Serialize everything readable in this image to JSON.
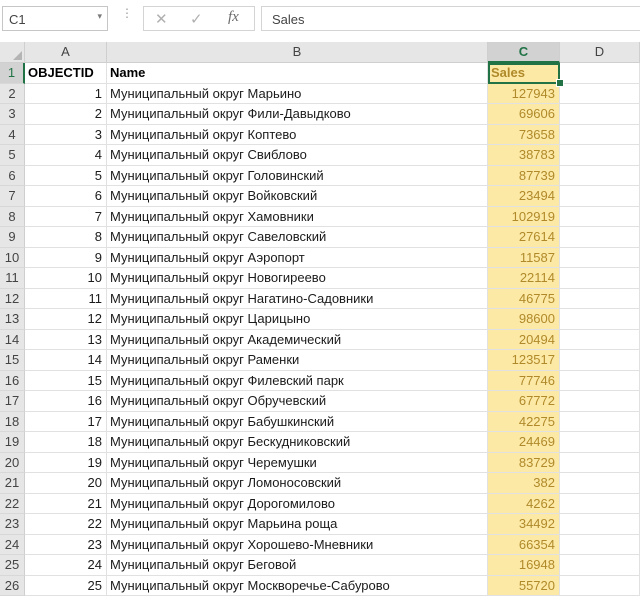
{
  "formula_bar": {
    "name_box": "C1",
    "name_box_arrow": "▾",
    "dots": "⋮",
    "cancel_icon": "✕",
    "enter_icon": "✓",
    "fx_label": "fx",
    "formula_value": "Sales"
  },
  "columns": [
    {
      "letter": "A"
    },
    {
      "letter": "B"
    },
    {
      "letter": "C"
    },
    {
      "letter": "D"
    }
  ],
  "selected_column": "C",
  "selected_row": "1",
  "headers": {
    "a": "OBJECTID",
    "b": "Name",
    "c": "Sales"
  },
  "rows": [
    {
      "n": "2",
      "id": "1",
      "name": "Муниципальный округ Марьино",
      "sales": "127943"
    },
    {
      "n": "3",
      "id": "2",
      "name": "Муниципальный округ Фили-Давыдково",
      "sales": "69606"
    },
    {
      "n": "4",
      "id": "3",
      "name": "Муниципальный округ Коптево",
      "sales": "73658"
    },
    {
      "n": "5",
      "id": "4",
      "name": "Муниципальный округ Свиблово",
      "sales": "38783"
    },
    {
      "n": "6",
      "id": "5",
      "name": "Муниципальный округ Головинский",
      "sales": "87739"
    },
    {
      "n": "7",
      "id": "6",
      "name": "Муниципальный округ Войковский",
      "sales": "23494"
    },
    {
      "n": "8",
      "id": "7",
      "name": "Муниципальный округ Хамовники",
      "sales": "102919"
    },
    {
      "n": "9",
      "id": "8",
      "name": "Муниципальный округ Савеловский",
      "sales": "27614"
    },
    {
      "n": "10",
      "id": "9",
      "name": "Муниципальный округ Аэропорт",
      "sales": "11587"
    },
    {
      "n": "11",
      "id": "10",
      "name": "Муниципальный округ Новогиреево",
      "sales": "22114"
    },
    {
      "n": "12",
      "id": "11",
      "name": "Муниципальный округ Нагатино-Садовники",
      "sales": "46775"
    },
    {
      "n": "13",
      "id": "12",
      "name": "Муниципальный округ Царицыно",
      "sales": "98600"
    },
    {
      "n": "14",
      "id": "13",
      "name": "Муниципальный округ Академический",
      "sales": "20494"
    },
    {
      "n": "15",
      "id": "14",
      "name": "Муниципальный округ Раменки",
      "sales": "123517"
    },
    {
      "n": "16",
      "id": "15",
      "name": "Муниципальный округ Филевский парк",
      "sales": "77746"
    },
    {
      "n": "17",
      "id": "16",
      "name": "Муниципальный округ Обручевский",
      "sales": "67772"
    },
    {
      "n": "18",
      "id": "17",
      "name": "Муниципальный округ Бабушкинский",
      "sales": "42275"
    },
    {
      "n": "19",
      "id": "18",
      "name": "Муниципальный округ Бескудниковский",
      "sales": "24469"
    },
    {
      "n": "20",
      "id": "19",
      "name": "Муниципальный округ Черемушки",
      "sales": "83729"
    },
    {
      "n": "21",
      "id": "20",
      "name": "Муниципальный округ Ломоносовский",
      "sales": "382"
    },
    {
      "n": "22",
      "id": "21",
      "name": "Муниципальный округ Дорогомилово",
      "sales": "4262"
    },
    {
      "n": "23",
      "id": "22",
      "name": "Муниципальный округ Марьина роща",
      "sales": "34492"
    },
    {
      "n": "24",
      "id": "23",
      "name": "Муниципальный округ Хорошево-Мневники",
      "sales": "66354"
    },
    {
      "n": "25",
      "id": "24",
      "name": "Муниципальный округ Беговой",
      "sales": "16948"
    },
    {
      "n": "26",
      "id": "25",
      "name": "Муниципальный округ Москворечье-Сабурово",
      "sales": "55720"
    }
  ],
  "colors": {
    "selection_green": "#217346",
    "sales_fill": "#fde9a6",
    "sales_text": "#b08a2a",
    "header_gray": "#e6e6e6"
  }
}
